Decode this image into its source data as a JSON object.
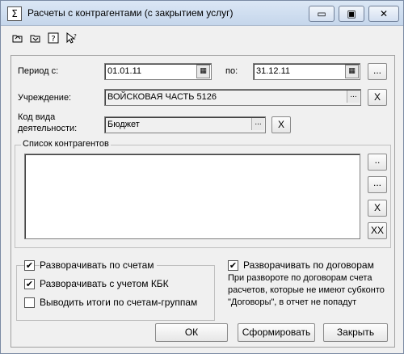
{
  "window": {
    "title": "Расчеты с контрагентами (с закрытием услуг)"
  },
  "titlebar_buttons": {
    "minimize": "▭",
    "maximize": "▣",
    "close": "✕"
  },
  "toolbar": {
    "icons": [
      "open-folder-icon",
      "save-folder-icon",
      "help-icon",
      "pointer-help-icon"
    ]
  },
  "period": {
    "label_from": "Период с:",
    "from": "01.01.11",
    "label_to": "по:",
    "to": "31.12.11",
    "more": "..."
  },
  "institution": {
    "label": "Учреждение:",
    "value": "ВОЙСКОВАЯ ЧАСТЬ 5126",
    "select": "...",
    "clear": "X"
  },
  "activity": {
    "label_line1": "Код вида",
    "label_line2": "деятельности:",
    "value": "Бюджет",
    "select": "...",
    "clear": "X"
  },
  "counterparties": {
    "title": "Список контрагентов",
    "btn_select": "..",
    "btn_add": "...",
    "btn_remove": "X",
    "btn_clear": "XX"
  },
  "options": {
    "by_accounts": {
      "label": "Разворачивать по счетам",
      "checked": true,
      "mark": "✔"
    },
    "with_kbk": {
      "label": "Разворачивать с учетом КБК",
      "checked": true,
      "mark": "✔"
    },
    "group_totals": {
      "label": "Выводить итоги по счетам-группам",
      "checked": false,
      "mark": ""
    },
    "by_contracts": {
      "label": "Разворачивать по договорам",
      "checked": true,
      "mark": "✔"
    },
    "note": "При развороте по договорам счета расчетов, которые не имеют субконто \"Договоры\", в отчет не попадут"
  },
  "buttons": {
    "ok": "ОК",
    "generate": "Сформировать",
    "close": "Закрыть"
  }
}
